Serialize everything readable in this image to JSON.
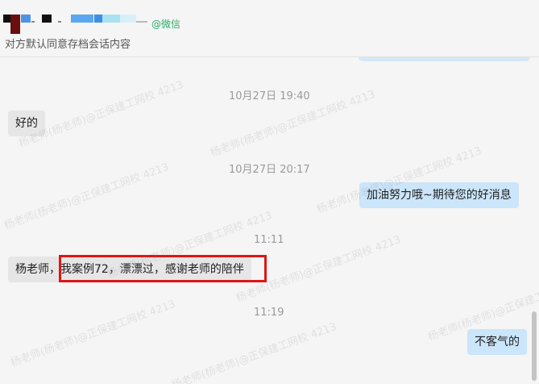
{
  "header": {
    "wechat_tag": "@微信",
    "consent_note": "对方默认同意存档会话内容"
  },
  "colors": {
    "incoming_bubble": "#e6e6e6",
    "outgoing_bubble": "#cbe5fa",
    "highlight": "#e01515",
    "wechat_green": "#2aae67"
  },
  "messages": {
    "ts1": "10月27日 19:40",
    "msg1": "好的",
    "ts2": "10月27日 20:17",
    "msg2": "加油努力哦~期待您的好消息",
    "ts3": "11:11",
    "msg3_prefix": "杨老师，",
    "msg3_highlight": "我案例72，漂漂过，感谢老师的陪伴",
    "ts4": "11:19",
    "msg4": "不客气的"
  },
  "watermark_text": "杨老师(杨老师)@正保建工网校 4213"
}
